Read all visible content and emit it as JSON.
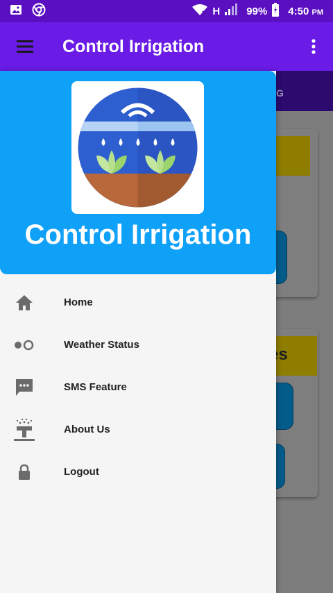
{
  "status_bar": {
    "network": "H",
    "battery": "99%",
    "time": "4:50",
    "time_suffix": "PM"
  },
  "app_bar": {
    "title": "Control Irrigation"
  },
  "background": {
    "tab_fragment": "G",
    "card_text_fragment": "es"
  },
  "drawer": {
    "title": "Control Irrigation",
    "menu": [
      {
        "label": "Home",
        "icon": "home-icon"
      },
      {
        "label": "Weather Status",
        "icon": "toggle-dots-icon"
      },
      {
        "label": "SMS Feature",
        "icon": "sms-icon"
      },
      {
        "label": "About Us",
        "icon": "sprinkler-icon"
      },
      {
        "label": "Logout",
        "icon": "lock-icon"
      }
    ]
  },
  "colors": {
    "status_bar": "#5a0fc0",
    "app_bar": "#6a1be6",
    "drawer_header": "#0fa0f7",
    "drawer_bg": "#f5f5f5"
  }
}
